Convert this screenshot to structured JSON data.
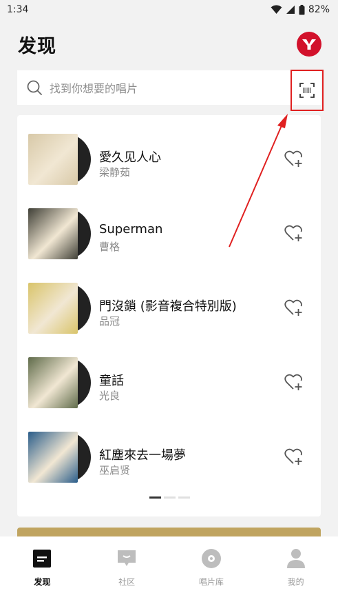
{
  "status_bar": {
    "time": "1:34",
    "battery": "82%"
  },
  "header": {
    "title": "发现",
    "avatar_letter": "Y"
  },
  "search": {
    "placeholder": "找到你想要的唱片"
  },
  "albums": [
    {
      "title": "愛久见人心",
      "artist": "梁静茹",
      "cover_color": "#d8c9a8"
    },
    {
      "title": "Superman",
      "artist": "曹格",
      "cover_color": "#3f3f36"
    },
    {
      "title": "門沒鎖 (影音複合特別版)",
      "artist": "品冠",
      "cover_color": "#d9c46a"
    },
    {
      "title": "童話",
      "artist": "光良",
      "cover_color": "#5f6b4a"
    },
    {
      "title": "紅塵來去一場夢",
      "artist": "巫启贤",
      "cover_color": "#2a5d8a"
    }
  ],
  "tabs": [
    {
      "label": "发现",
      "active": true
    },
    {
      "label": "社区",
      "active": false
    },
    {
      "label": "唱片库",
      "active": false
    },
    {
      "label": "我的",
      "active": false
    }
  ],
  "colors": {
    "accent_red": "#e02020",
    "brand_gold": "#c0a460",
    "avatar_red": "#d2112b"
  }
}
